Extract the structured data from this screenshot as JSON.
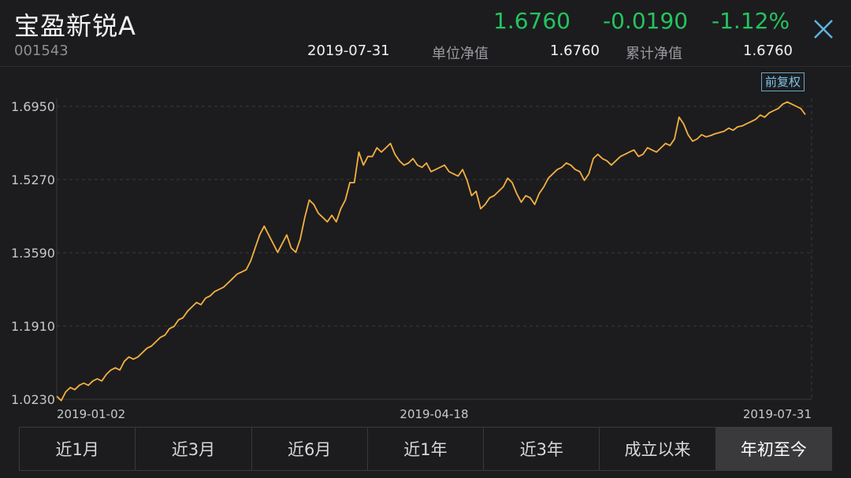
{
  "header": {
    "fund_name": "宝盈新锐A",
    "fund_code": "001543",
    "nav": "1.6760",
    "change": "-0.0190",
    "change_pct": "-1.12%",
    "date": "2019-07-31",
    "unit_nav_label": "单位净值",
    "unit_nav_value": "1.6760",
    "cum_nav_label": "累计净值",
    "cum_nav_value": "1.6760",
    "close_icon": "close-icon"
  },
  "adjust_label": "前复权",
  "colors": {
    "background": "#1c1c1e",
    "line": "#f5b041",
    "quote_green": "#22c55e",
    "grid": "#3a3a3c"
  },
  "chart_data": {
    "type": "line",
    "y_ticks": [
      "1.6950",
      "1.5270",
      "1.3590",
      "1.1910",
      "1.0230"
    ],
    "x_ticks": [
      "2019-01-02",
      "2019-04-18",
      "2019-07-31"
    ],
    "ylim": [
      1.023,
      1.695
    ],
    "grid": true,
    "series": [
      {
        "values": [
          1.03,
          1.02,
          1.04,
          1.05,
          1.045,
          1.055,
          1.06,
          1.055,
          1.065,
          1.07,
          1.065,
          1.08,
          1.09,
          1.095,
          1.09,
          1.11,
          1.12,
          1.115,
          1.12,
          1.13,
          1.14,
          1.145,
          1.155,
          1.165,
          1.17,
          1.185,
          1.19,
          1.205,
          1.21,
          1.225,
          1.235,
          1.245,
          1.24,
          1.255,
          1.26,
          1.27,
          1.275,
          1.28,
          1.29,
          1.3,
          1.31,
          1.315,
          1.32,
          1.34,
          1.37,
          1.4,
          1.42,
          1.4,
          1.38,
          1.36,
          1.38,
          1.4,
          1.37,
          1.36,
          1.39,
          1.44,
          1.48,
          1.47,
          1.45,
          1.44,
          1.43,
          1.445,
          1.43,
          1.46,
          1.48,
          1.52,
          1.52,
          1.59,
          1.56,
          1.58,
          1.58,
          1.6,
          1.59,
          1.6,
          1.61,
          1.585,
          1.57,
          1.56,
          1.565,
          1.575,
          1.56,
          1.555,
          1.565,
          1.545,
          1.55,
          1.555,
          1.56,
          1.545,
          1.54,
          1.535,
          1.55,
          1.525,
          1.49,
          1.5,
          1.46,
          1.47,
          1.485,
          1.49,
          1.5,
          1.51,
          1.53,
          1.52,
          1.495,
          1.475,
          1.49,
          1.485,
          1.47,
          1.495,
          1.51,
          1.53,
          1.54,
          1.55,
          1.555,
          1.565,
          1.56,
          1.55,
          1.545,
          1.525,
          1.54,
          1.575,
          1.585,
          1.575,
          1.57,
          1.56,
          1.57,
          1.58,
          1.585,
          1.59,
          1.595,
          1.58,
          1.585,
          1.6,
          1.595,
          1.59,
          1.6,
          1.61,
          1.605,
          1.62,
          1.67,
          1.655,
          1.63,
          1.615,
          1.62,
          1.63,
          1.625,
          1.628,
          1.632,
          1.635,
          1.638,
          1.645,
          1.64,
          1.648,
          1.65,
          1.655,
          1.66,
          1.665,
          1.675,
          1.67,
          1.68,
          1.685,
          1.69,
          1.7,
          1.705,
          1.7,
          1.695,
          1.69,
          1.676
        ]
      }
    ]
  },
  "tabs": [
    {
      "label": "近1月",
      "active": false
    },
    {
      "label": "近3月",
      "active": false
    },
    {
      "label": "近6月",
      "active": false
    },
    {
      "label": "近1年",
      "active": false
    },
    {
      "label": "近3年",
      "active": false
    },
    {
      "label": "成立以来",
      "active": false
    },
    {
      "label": "年初至今",
      "active": true
    }
  ]
}
